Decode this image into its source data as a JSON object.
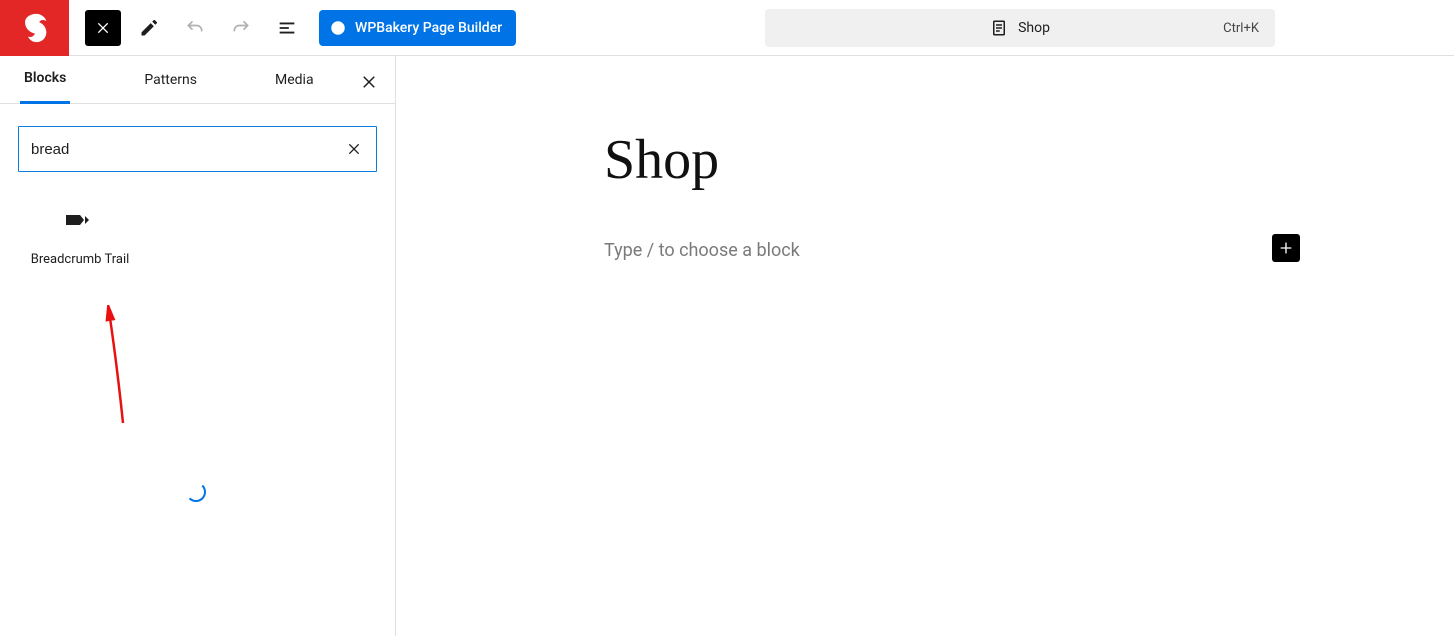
{
  "topbar": {
    "wpbakery_label": "WPBakery Page Builder",
    "search_title": "Shop",
    "search_shortcut": "Ctrl+K"
  },
  "sidebar": {
    "tabs": {
      "blocks": "Blocks",
      "patterns": "Patterns",
      "media": "Media"
    },
    "search_value": "bread",
    "result_label": "Breadcrumb Trail"
  },
  "content": {
    "title": "Shop",
    "placeholder": "Type / to choose a block"
  }
}
